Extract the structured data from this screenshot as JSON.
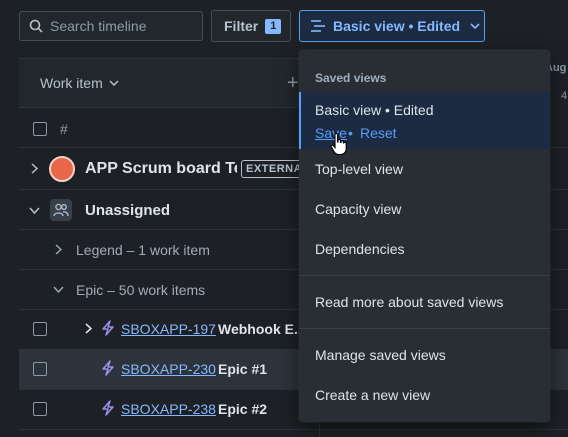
{
  "toolbar": {
    "search_placeholder": "Search timeline",
    "filter_label": "Filter",
    "filter_count": "1",
    "view_label": "Basic view • Edited"
  },
  "table": {
    "work_item_header": "Work item",
    "hash_header": "#",
    "add_symbol": "+",
    "month_abbrev": "Aug",
    "day_partial": "4",
    "rows": {
      "app": {
        "name": "APP Scrum board Tea",
        "badge": "EXTERNAL"
      },
      "unassigned": {
        "label": "Unassigned"
      },
      "legend": {
        "label": "Legend – 1 work item"
      },
      "epic_group": {
        "label": "Epic – 50 work items"
      },
      "epics": [
        {
          "key": "SBOXAPP-197",
          "title": "Webhook E..."
        },
        {
          "key": "SBOXAPP-230",
          "title": "Epic #1"
        },
        {
          "key": "SBOXAPP-238",
          "title": "Epic #2"
        }
      ]
    }
  },
  "menu": {
    "heading": "Saved views",
    "selected": {
      "title": "Basic view • Edited",
      "save": "Save",
      "dot": "•",
      "reset": "Reset"
    },
    "views": [
      "Top-level view",
      "Capacity view",
      "Dependencies"
    ],
    "read_more": "Read more about saved views",
    "manage": "Manage saved views",
    "create": "Create a new view"
  },
  "colors": {
    "background": "#1d2125",
    "accent": "#579dff",
    "menu_bg": "#282e33",
    "selected_bg": "#1c2b41",
    "epic_icon": "#9f8fef"
  }
}
